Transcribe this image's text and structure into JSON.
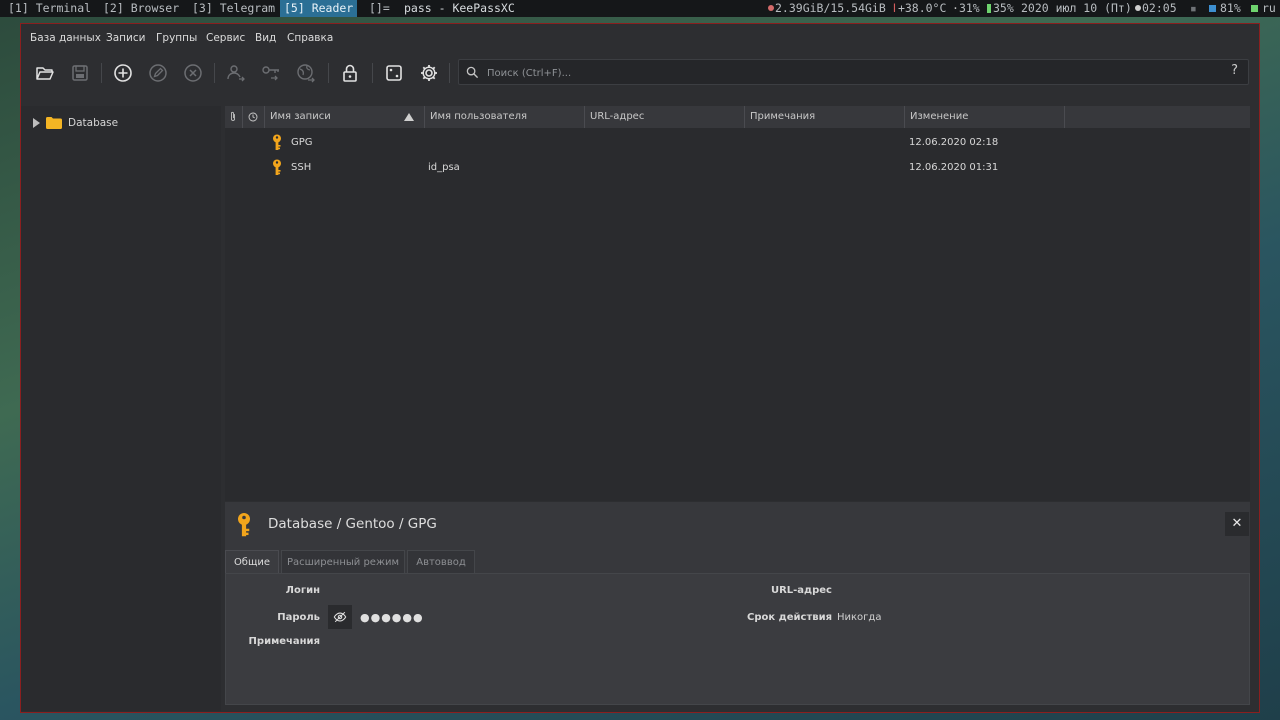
{
  "topbar": {
    "workspaces": [
      {
        "label": "[1] Terminal",
        "active": false
      },
      {
        "label": "[2] Browser",
        "active": false
      },
      {
        "label": "[3] Telegram",
        "active": false
      },
      {
        "label": "[5] Reader",
        "active": true
      }
    ],
    "layout_indicator": "[]=",
    "window_title": "pass - KeePassXC",
    "memory": "2.39GiB/15.54GiB",
    "temperature": "+38.0°C",
    "cpu": "31%",
    "battery": "35%",
    "date": "2020 июл 10 (Пт)",
    "time": "02:05",
    "volume": "81%",
    "keyboard_layout": "ru",
    "colors": {
      "active_workspace": "#2b6f95"
    }
  },
  "menu": {
    "items": [
      "База данных",
      "Записи",
      "Группы",
      "Сервис",
      "Вид",
      "Справка"
    ]
  },
  "toolbar": {
    "buttons": [
      "open-database-icon",
      "save-database-icon",
      "add-entry-icon",
      "edit-entry-icon",
      "delete-entry-icon",
      "copy-username-icon",
      "copy-password-icon",
      "open-url-icon",
      "lock-database-icon",
      "password-generator-icon",
      "settings-icon"
    ],
    "search_placeholder": "Поиск (Ctrl+F)...",
    "search_value": "",
    "help_label": "?"
  },
  "groups": {
    "root": "Database"
  },
  "entries": {
    "columns": [
      "Имя записи",
      "Имя пользователя",
      "URL-адрес",
      "Примечания",
      "Изменение"
    ],
    "rows": [
      {
        "title": "GPG",
        "username": "",
        "url": "",
        "notes": "",
        "modified": "12.06.2020 02:18"
      },
      {
        "title": "SSH",
        "username": "id_psa",
        "url": "",
        "notes": "",
        "modified": "12.06.2020 01:31"
      }
    ]
  },
  "preview": {
    "title": "Database / Gentoo / GPG",
    "close_label": "✕",
    "tabs": [
      "Общие",
      "Расширенный режим",
      "Автоввод"
    ],
    "labels": {
      "login": "Логин",
      "password": "Пароль",
      "notes": "Примечания",
      "url": "URL-адрес",
      "expiration": "Срок действия"
    },
    "password_masked": "●●●●●●",
    "expiration_value": "Никогда"
  },
  "colors": {
    "window_border": "#8a1f1f",
    "key_icon": "#f2a51c",
    "folder_icon": "#f4b524"
  }
}
